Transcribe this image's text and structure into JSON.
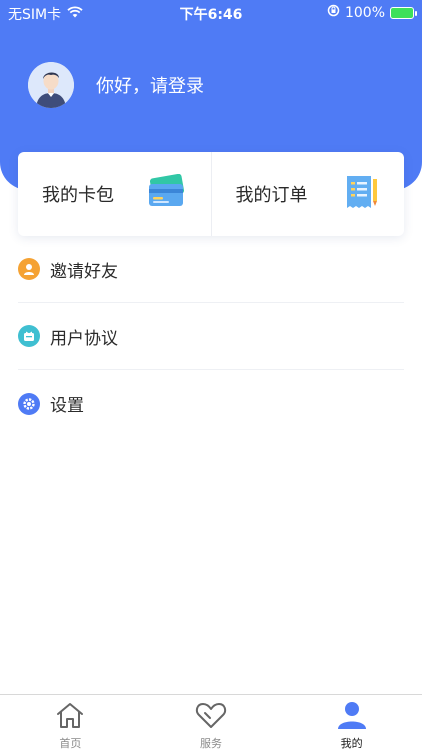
{
  "status_bar": {
    "carrier": "无SIM卡",
    "time": "下午6:46",
    "battery": "100%"
  },
  "profile": {
    "greeting": "你好，请登录"
  },
  "cards": [
    {
      "label": "我的卡包",
      "icon": "card-wallet-icon"
    },
    {
      "label": "我的订单",
      "icon": "order-list-icon"
    }
  ],
  "menu": [
    {
      "label": "邀请好友",
      "icon": "invite-friend-icon",
      "color": "#f5a233"
    },
    {
      "label": "用户协议",
      "icon": "user-agreement-icon",
      "color": "#3fbfd1"
    },
    {
      "label": "设置",
      "icon": "settings-icon",
      "color": "#4f7bf5"
    }
  ],
  "tabbar": [
    {
      "label": "首页",
      "icon": "home-icon",
      "active": false
    },
    {
      "label": "服务",
      "icon": "heart-icon",
      "active": false
    },
    {
      "label": "我的",
      "icon": "user-icon",
      "active": true
    }
  ],
  "colors": {
    "brand": "#4f7bf5",
    "active_tab": "#4f7bf5"
  }
}
